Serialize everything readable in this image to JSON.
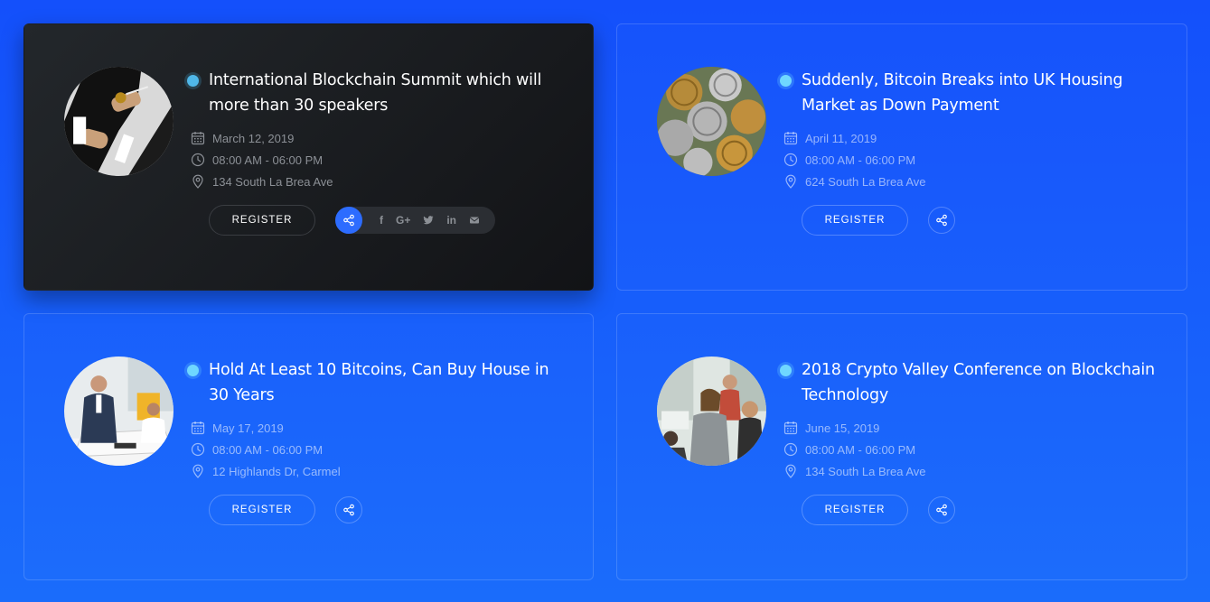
{
  "events": [
    {
      "title": "International Blockchain Summit which will more than 30 speakers",
      "date": "March 12, 2019",
      "time": "08:00 AM - 06:00 PM",
      "location": "134 South La Brea Ave",
      "register_label": "REGISTER",
      "image": "man-in-suit-with-bitcoin"
    },
    {
      "title": "Suddenly, Bitcoin Breaks into UK Housing Market as Down Payment",
      "date": "April 11, 2019",
      "time": "08:00 AM - 06:00 PM",
      "location": "624 South La Brea Ave",
      "register_label": "REGISTER",
      "image": "bitcoin-coins-and-dollars"
    },
    {
      "title": "Hold At Least 10 Bitcoins, Can Buy House in 30 Years",
      "date": "May 17, 2019",
      "time": "08:00 AM - 06:00 PM",
      "location": "12 Highlands Dr, Carmel",
      "register_label": "REGISTER",
      "image": "office-meeting"
    },
    {
      "title": "2018 Crypto Valley Conference on Blockchain Technology",
      "date": "June 15, 2019",
      "time": "08:00 AM - 06:00 PM",
      "location": "134 South La Brea Ave",
      "register_label": "REGISTER",
      "image": "conference-team"
    }
  ],
  "social_icons": [
    "facebook-icon",
    "google-plus-icon",
    "twitter-icon",
    "linkedin-icon",
    "email-icon"
  ],
  "colors": {
    "background": "#1450fb",
    "dark_card": "#1a1d21",
    "accent": "#2d6cff",
    "dot": "#6fd7ff"
  }
}
